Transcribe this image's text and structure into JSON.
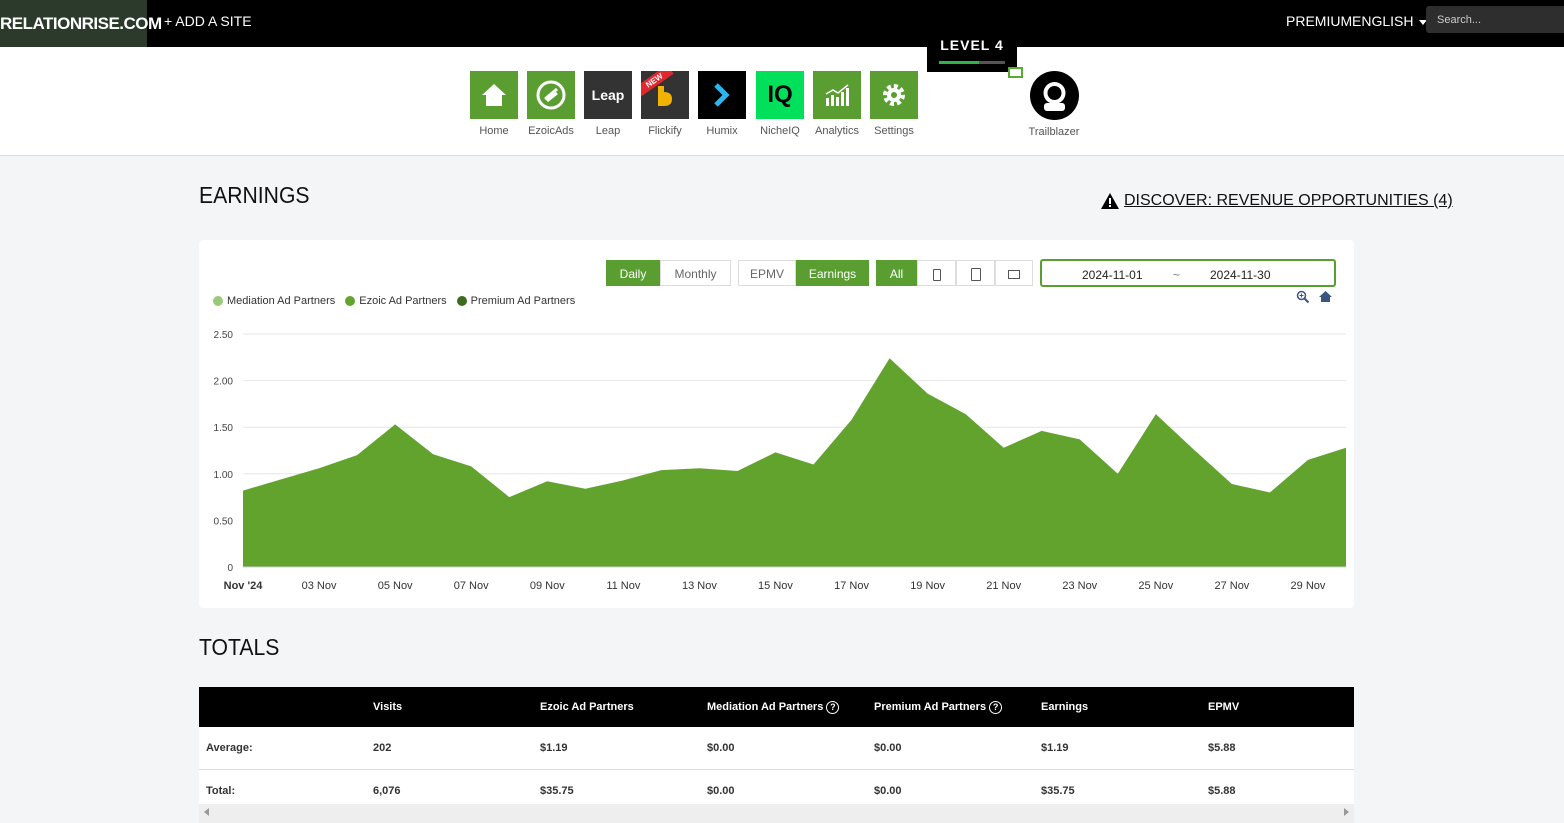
{
  "topbar": {
    "brand": "RELATIONRISE.COM",
    "add_site": "+ ADD A SITE",
    "premium": "PREMIUM",
    "language": "ENGLISH",
    "search_placeholder": "Search..."
  },
  "apps": [
    {
      "label": "Home",
      "icon": "home-icon",
      "color": "#5a9e32"
    },
    {
      "label": "EzoicAds",
      "icon": "ezoic-ads-icon",
      "color": "#5a9e32"
    },
    {
      "label": "Leap",
      "icon": "leap-icon",
      "color": "#333333",
      "tile_text": "Leap"
    },
    {
      "label": "Flickify",
      "icon": "flickify-icon",
      "color": "#333333",
      "badge": "NEW"
    },
    {
      "label": "Humix",
      "icon": "humix-icon",
      "color": "#000000"
    },
    {
      "label": "NicheIQ",
      "icon": "nicheiq-icon",
      "color": "#00e05a",
      "tile_text": "IQ"
    },
    {
      "label": "Analytics",
      "icon": "analytics-icon",
      "color": "#5a9e32"
    },
    {
      "label": "Settings",
      "icon": "settings-icon",
      "color": "#5a9e32"
    }
  ],
  "level": {
    "label": "LEVEL 4",
    "progress": 0.6
  },
  "trailblazer": {
    "label": "Trailblazer"
  },
  "earnings": {
    "title": "EARNINGS",
    "discover": "DISCOVER: REVENUE OPPORTUNITIES (4)",
    "period_buttons": [
      "Daily",
      "Monthly"
    ],
    "metric_buttons": [
      "EPMV",
      "Earnings"
    ],
    "device_all": "All",
    "date_start": "2024-11-01",
    "date_sep": "~",
    "date_end": "2024-11-30"
  },
  "chart_data": {
    "type": "area",
    "series": [
      {
        "name": "Mediation Ad Partners",
        "color": "#9bc97a",
        "values": [
          0,
          0,
          0,
          0,
          0,
          0,
          0,
          0,
          0,
          0,
          0,
          0,
          0,
          0,
          0,
          0,
          0,
          0,
          0,
          0,
          0,
          0,
          0,
          0,
          0,
          0,
          0,
          0,
          0,
          0
        ]
      },
      {
        "name": "Ezoic Ad Partners",
        "color": "#62a32e",
        "values": [
          0.82,
          0.94,
          1.06,
          1.2,
          1.53,
          1.21,
          1.08,
          0.75,
          0.92,
          0.84,
          0.93,
          1.04,
          1.06,
          1.03,
          1.23,
          1.1,
          1.58,
          2.24,
          1.86,
          1.64,
          1.28,
          1.46,
          1.37,
          1.0,
          1.64,
          1.26,
          0.89,
          0.8,
          1.15,
          1.28
        ]
      },
      {
        "name": "Premium Ad Partners",
        "color": "#3b6b1d",
        "values": [
          0,
          0,
          0,
          0,
          0,
          0,
          0,
          0,
          0,
          0,
          0,
          0,
          0,
          0,
          0,
          0,
          0,
          0,
          0,
          0,
          0,
          0,
          0,
          0,
          0,
          0,
          0,
          0,
          0,
          0
        ]
      }
    ],
    "x_tick_labels": [
      "Nov '24",
      "03 Nov",
      "05 Nov",
      "07 Nov",
      "09 Nov",
      "11 Nov",
      "13 Nov",
      "15 Nov",
      "17 Nov",
      "19 Nov",
      "21 Nov",
      "23 Nov",
      "25 Nov",
      "27 Nov",
      "29 Nov"
    ],
    "y_tick_labels": [
      "0",
      "0.50",
      "1.00",
      "1.50",
      "2.00",
      "2.50"
    ],
    "ylim": [
      0,
      2.5
    ],
    "grid": true,
    "legend": "top-left"
  },
  "totals": {
    "title": "TOTALS",
    "columns": [
      "",
      "Visits",
      "Ezoic Ad Partners",
      "Mediation Ad Partners",
      "Premium Ad Partners",
      "Earnings",
      "EPMV"
    ],
    "rows": [
      [
        "Average:",
        "202",
        "$1.19",
        "$0.00",
        "$0.00",
        "$1.19",
        "$5.88"
      ],
      [
        "Total:",
        "6,076",
        "$35.75",
        "$0.00",
        "$0.00",
        "$35.75",
        "$5.88"
      ]
    ]
  }
}
